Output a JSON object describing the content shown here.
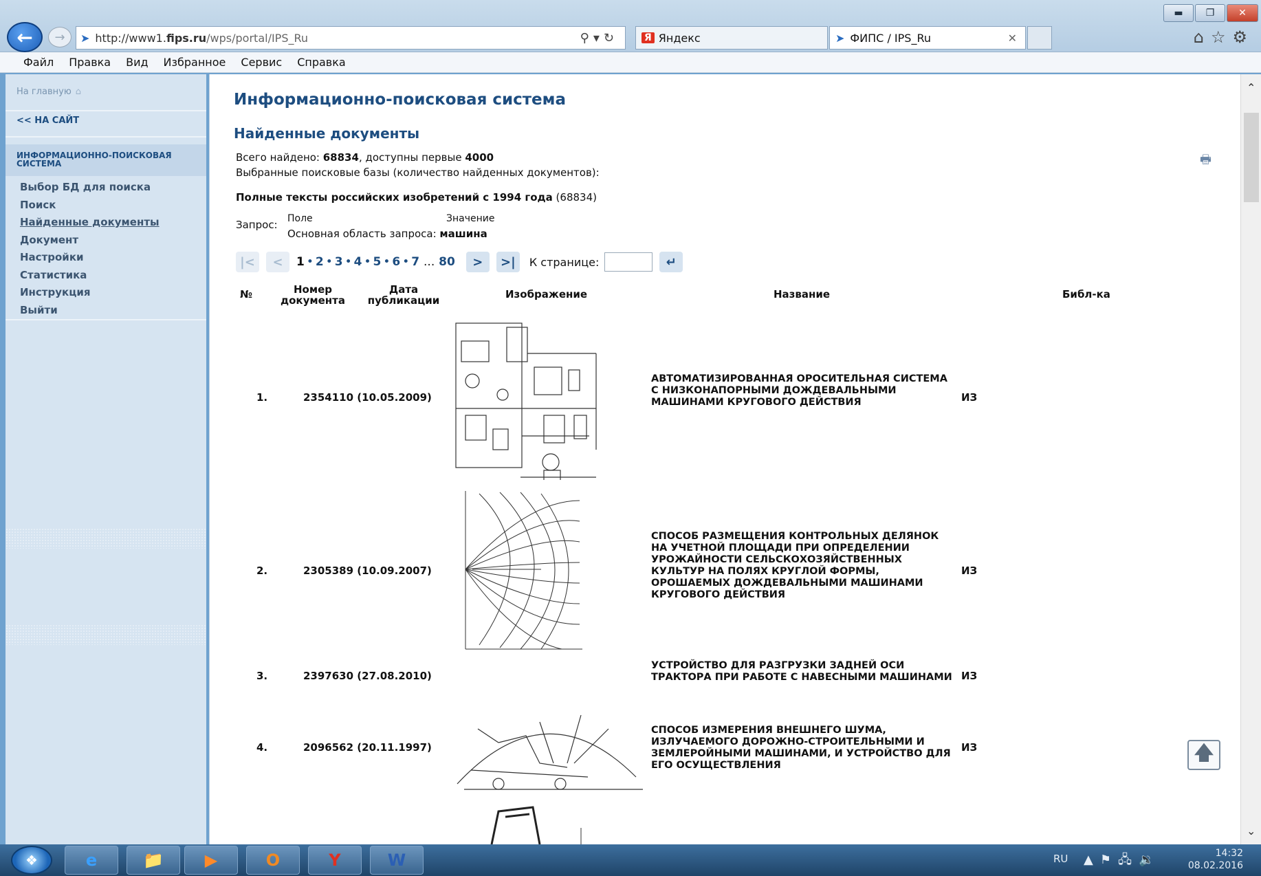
{
  "browser": {
    "url_prefix": "http://www1.",
    "url_domain": "fips.ru",
    "url_path": "/wps/portal/IPS_Ru",
    "tabs": [
      {
        "label": "Яндекс"
      },
      {
        "label": "ФИПС / IPS_Ru"
      }
    ],
    "menu": [
      "Файл",
      "Правка",
      "Вид",
      "Избранное",
      "Сервис",
      "Справка"
    ]
  },
  "sidebar": {
    "home": "На главную",
    "back": "<< НА САЙТ",
    "section_line1": "ИНФОРМАЦИОННО-ПОИСКОВАЯ",
    "section_line2": "СИСТЕМА",
    "nav": [
      {
        "label": "Выбор БД для поиска"
      },
      {
        "label": "Поиск"
      },
      {
        "label": "Найденные документы"
      },
      {
        "label": "Документ"
      },
      {
        "label": "Настройки"
      },
      {
        "label": "Статистика"
      },
      {
        "label": "Инструкция"
      },
      {
        "label": "Выйти"
      }
    ]
  },
  "main": {
    "title": "Информационно-поисковая система",
    "subtitle": "Найденные документы",
    "found_prefix": "Всего найдено: ",
    "found_total": "68834",
    "found_mid": ", доступны первые ",
    "found_available": "4000",
    "bases_line": "Выбранные поисковые базы (количество найденных документов):",
    "base_name": "Полные тексты российских изобретений с 1994 года",
    "base_count": " (68834)",
    "query": {
      "label": "Запрос:",
      "col_field": "Поле",
      "col_value": "Значение",
      "field": "Основная область запроса: ",
      "value": "машина"
    },
    "pager": {
      "first": "|<",
      "prev": "<",
      "next": ">",
      "last": ">|",
      "pages": [
        "1",
        "2",
        "3",
        "4",
        "5",
        "6",
        "7"
      ],
      "ellipsis": "...",
      "last_page": "80",
      "goto_label": "К странице:",
      "goto_value": "",
      "goto_button": "↵"
    },
    "table": {
      "headers": {
        "num": "№",
        "doc_line1": "Номер",
        "doc_line2": "документа",
        "date_line1": "Дата",
        "date_line2": "публикации",
        "image": "Изображение",
        "title": "Название",
        "lib": "Библ-ка"
      },
      "rows": [
        {
          "num": "1.",
          "doc": "2354110 (10.05.2009)",
          "title": "АВТОМАТИЗИРОВАННАЯ ОРОСИТЕЛЬНАЯ СИСТЕМА С НИЗКОНАПОРНЫМИ ДОЖДЕВАЛЬНЫМИ МАШИНАМИ КРУГОВОГО ДЕЙСТВИЯ",
          "lib": "ИЗ"
        },
        {
          "num": "2.",
          "doc": "2305389 (10.09.2007)",
          "title": "СПОСОБ РАЗМЕЩЕНИЯ КОНТРОЛЬНЫХ ДЕЛЯНОК НА УЧЕТНОЙ ПЛОЩАДИ ПРИ ОПРЕДЕЛЕНИИ УРОЖАЙНОСТИ СЕЛЬСКОХОЗЯЙСТВЕННЫХ КУЛЬТУР НА ПОЛЯХ КРУГЛОЙ ФОРМЫ, ОРОШАЕМЫХ ДОЖДЕВАЛЬНЫМИ МАШИНАМИ КРУГОВОГО ДЕЙСТВИЯ",
          "lib": "ИЗ"
        },
        {
          "num": "3.",
          "doc": "2397630 (27.08.2010)",
          "title": "УСТРОЙСТВО ДЛЯ РАЗГРУЗКИ ЗАДНЕЙ ОСИ ТРАКТОРА ПРИ РАБОТЕ С НАВЕСНЫМИ МАШИНАМИ",
          "lib": "ИЗ"
        },
        {
          "num": "4.",
          "doc": "2096562 (20.11.1997)",
          "title": "СПОСОБ ИЗМЕРЕНИЯ ВНЕШНЕГО ШУМА, ИЗЛУЧАЕМОГО ДОРОЖНО-СТРОИТЕЛЬНЫМИ И ЗЕМЛЕРОЙНЫМИ МАШИНАМИ, И УСТРОЙСТВО ДЛЯ ЕГО ОСУЩЕСТВЛЕНИЯ",
          "lib": "ИЗ"
        }
      ]
    }
  },
  "taskbar": {
    "lang": "RU",
    "time": "14:32",
    "date": "08.02.2016"
  }
}
